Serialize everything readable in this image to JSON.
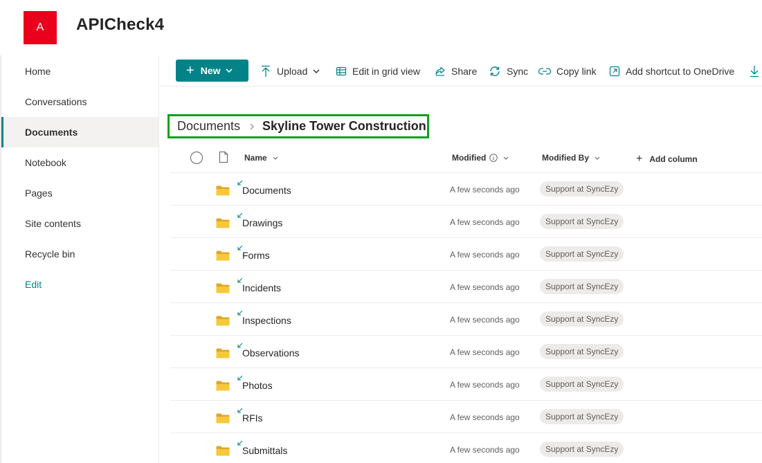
{
  "site": {
    "logo_letter": "A",
    "logo_color": "#e8001c",
    "title": "APICheck4"
  },
  "theme": {
    "accent": "#038387",
    "breadcrumb_highlight": "#0d9f1f"
  },
  "sidebar": {
    "items": [
      {
        "label": "Home"
      },
      {
        "label": "Conversations"
      },
      {
        "label": "Documents",
        "selected": true
      },
      {
        "label": "Notebook"
      },
      {
        "label": "Pages"
      },
      {
        "label": "Site contents"
      },
      {
        "label": "Recycle bin"
      },
      {
        "label": "Edit"
      }
    ]
  },
  "commandbar": {
    "new_label": "New",
    "upload_label": "Upload",
    "edit_grid_label": "Edit in grid view",
    "share_label": "Share",
    "sync_label": "Sync",
    "copy_link_label": "Copy link",
    "shortcut_label": "Add shortcut to OneDrive"
  },
  "breadcrumb": {
    "root": "Documents",
    "current": "Skyline Tower Construction"
  },
  "list": {
    "columns": {
      "name": "Name",
      "modified": "Modified",
      "modified_by": "Modified By",
      "add_column": "Add column"
    },
    "rows": [
      {
        "name": "Documents",
        "modified": "A few seconds ago",
        "modified_by": "Support at SyncEzy"
      },
      {
        "name": "Drawings",
        "modified": "A few seconds ago",
        "modified_by": "Support at SyncEzy"
      },
      {
        "name": "Forms",
        "modified": "A few seconds ago",
        "modified_by": "Support at SyncEzy"
      },
      {
        "name": "Incidents",
        "modified": "A few seconds ago",
        "modified_by": "Support at SyncEzy"
      },
      {
        "name": "Inspections",
        "modified": "A few seconds ago",
        "modified_by": "Support at SyncEzy"
      },
      {
        "name": "Observations",
        "modified": "A few seconds ago",
        "modified_by": "Support at SyncEzy"
      },
      {
        "name": "Photos",
        "modified": "A few seconds ago",
        "modified_by": "Support at SyncEzy"
      },
      {
        "name": "RFIs",
        "modified": "A few seconds ago",
        "modified_by": "Support at SyncEzy"
      },
      {
        "name": "Submittals",
        "modified": "A few seconds ago",
        "modified_by": "Support at SyncEzy"
      }
    ]
  }
}
